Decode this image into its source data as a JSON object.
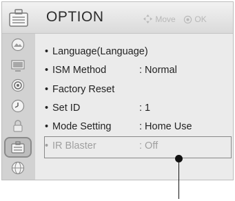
{
  "header": {
    "title": "OPTION",
    "icon": "option-suitcase-icon",
    "move_hint": "Move",
    "ok_hint": "OK"
  },
  "sidebar": {
    "items": [
      {
        "name": "picture-icon"
      },
      {
        "name": "tv-screen-icon"
      },
      {
        "name": "audio-icon"
      },
      {
        "name": "clock-icon"
      },
      {
        "name": "lock-icon"
      },
      {
        "name": "option-icon",
        "selected": true
      },
      {
        "name": "network-icon"
      }
    ]
  },
  "menu": {
    "items": [
      {
        "label": "Language(Language)",
        "value": ""
      },
      {
        "label": "ISM Method",
        "value": ": Normal"
      },
      {
        "label": "Factory Reset",
        "value": ""
      },
      {
        "label": "Set ID",
        "value": ": 1"
      },
      {
        "label": "Mode Setting",
        "value": ": Home Use"
      },
      {
        "label": "IR Blaster",
        "value": ": Off",
        "disabled": true
      }
    ]
  },
  "colors": {
    "header_bg": "#e8e8e8",
    "sidebar_bg": "#d2d2d2",
    "content_bg": "#ebebeb",
    "dim_text": "#9f9f9f"
  }
}
